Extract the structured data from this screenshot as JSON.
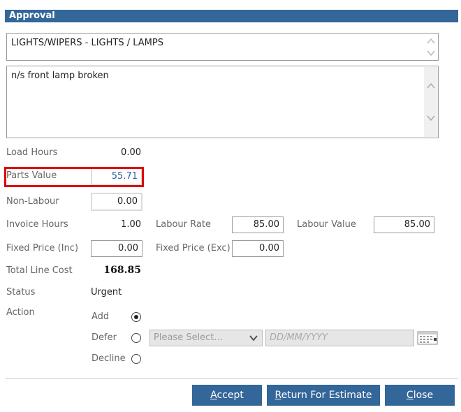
{
  "dialog": {
    "title": "Approval"
  },
  "operation": {
    "text": "LIGHTS/WIPERS - LIGHTS / LAMPS"
  },
  "notes": {
    "text": "n/s front lamp broken"
  },
  "load_hours": {
    "label": "Load Hours",
    "value": "0.00"
  },
  "parts_value": {
    "label": "Parts Value",
    "value": "55.71"
  },
  "non_labour": {
    "label": "Non-Labour",
    "value": "0.00"
  },
  "invoice_hours": {
    "label": "Invoice Hours",
    "value": "1.00"
  },
  "labour_rate": {
    "label": "Labour Rate",
    "value": "85.00"
  },
  "labour_value": {
    "label": "Labour Value",
    "value": "85.00"
  },
  "fixed_price_inc": {
    "label": "Fixed Price (Inc)",
    "value": "0.00"
  },
  "fixed_price_exc": {
    "label": "Fixed Price (Exc)",
    "value": "0.00"
  },
  "total_line_cost": {
    "label": "Total Line Cost",
    "value": "168.85"
  },
  "status": {
    "label": "Status",
    "value": "Urgent"
  },
  "action": {
    "label": "Action",
    "options": [
      "Add",
      "Defer",
      "Decline"
    ],
    "selected": "Add",
    "select_placeholder": "Please Select...",
    "date_placeholder": "DD/MM/YYYY"
  },
  "buttons": {
    "accept": {
      "first": "A",
      "rest": "ccept"
    },
    "return": {
      "first": "R",
      "rest": "eturn For Estimate"
    },
    "close": {
      "first": "C",
      "rest": "lose"
    }
  },
  "highlight_color": "#e00000",
  "accent_color": "#336699"
}
